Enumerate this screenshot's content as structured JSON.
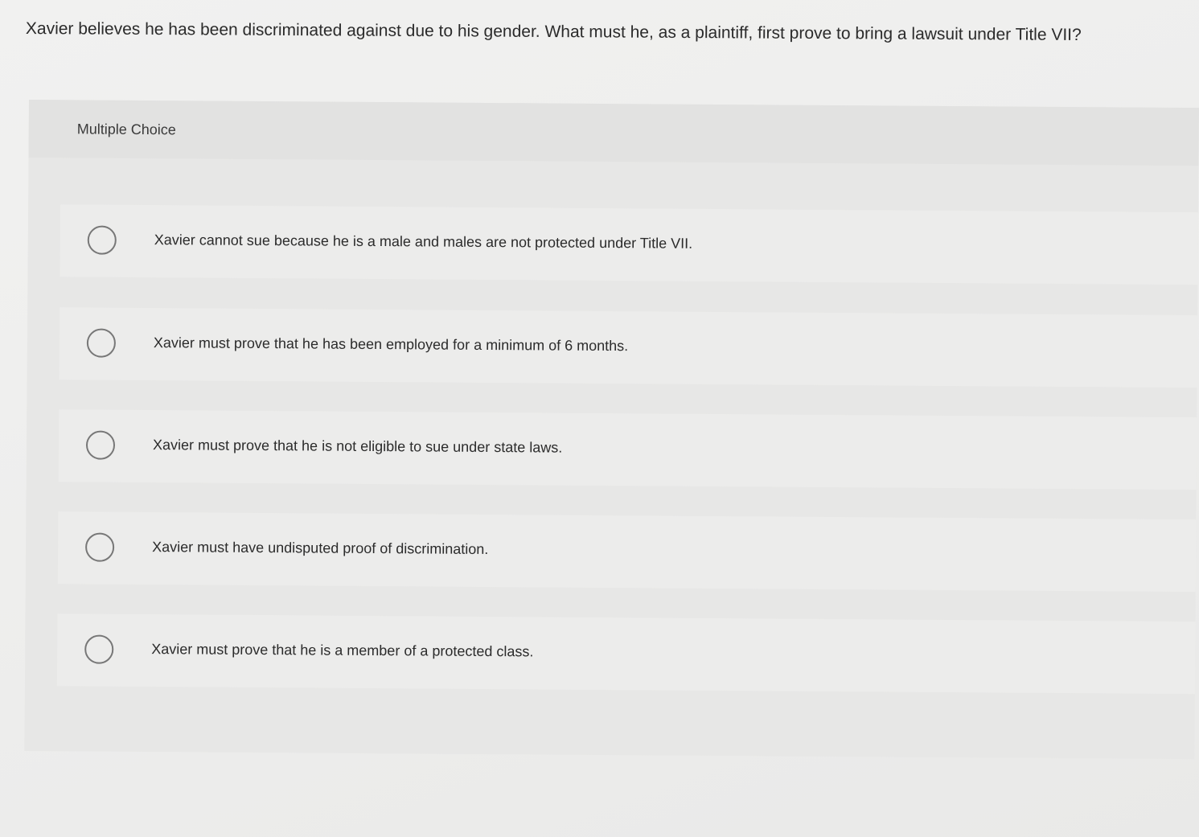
{
  "question": {
    "text": "Xavier believes he has been discriminated against due to his gender. What must he, as a plaintiff, first prove to bring a lawsuit under Title VII?"
  },
  "panel": {
    "header_label": "Multiple Choice",
    "options": [
      {
        "label": "Xavier cannot sue because he is a male and males are not protected under Title VII.",
        "selected": false
      },
      {
        "label": "Xavier must prove that he has been employed for a minimum of 6 months.",
        "selected": false
      },
      {
        "label": "Xavier must prove that he is not eligible to sue under state laws.",
        "selected": false
      },
      {
        "label": "Xavier must have undisputed proof of discrimination.",
        "selected": false
      },
      {
        "label": "Xavier must prove that he is a member of a protected class.",
        "selected": false
      }
    ]
  }
}
